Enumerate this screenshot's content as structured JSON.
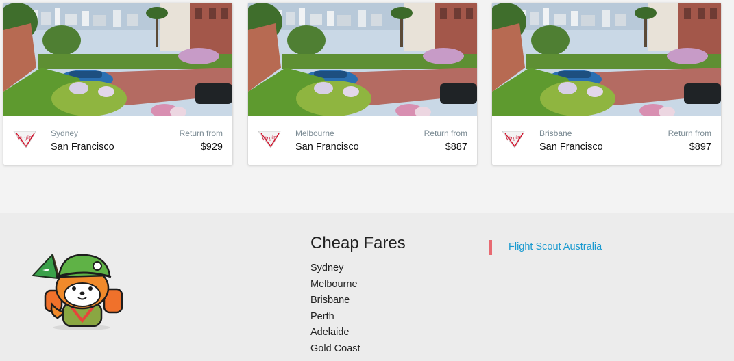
{
  "cards": [
    {
      "origin": "Sydney",
      "destination": "San Francisco",
      "return_label": "Return from",
      "price": "$929",
      "airline_logo": "virgin-australia-logo",
      "logo_text": "Virgin"
    },
    {
      "origin": "Melbourne",
      "destination": "San Francisco",
      "return_label": "Return from",
      "price": "$887",
      "airline_logo": "virgin-australia-logo",
      "logo_text": "Virgin"
    },
    {
      "origin": "Brisbane",
      "destination": "San Francisco",
      "return_label": "Return from",
      "price": "$897",
      "airline_logo": "virgin-australia-logo",
      "logo_text": "Virgin"
    }
  ],
  "footer": {
    "cheap_fares_title": "Cheap Fares",
    "cheap_fares": [
      "Sydney",
      "Melbourne",
      "Brisbane",
      "Perth",
      "Adelaide",
      "Gold Coast"
    ],
    "brand_link": "Flight Scout Australia",
    "mascot_icon": "fox-explorer-mascot"
  },
  "colors": {
    "link": "#1a9ad0",
    "accent_bar": "#e86a72",
    "footer_bg": "#ececec",
    "page_bg": "#f3f3f3"
  }
}
